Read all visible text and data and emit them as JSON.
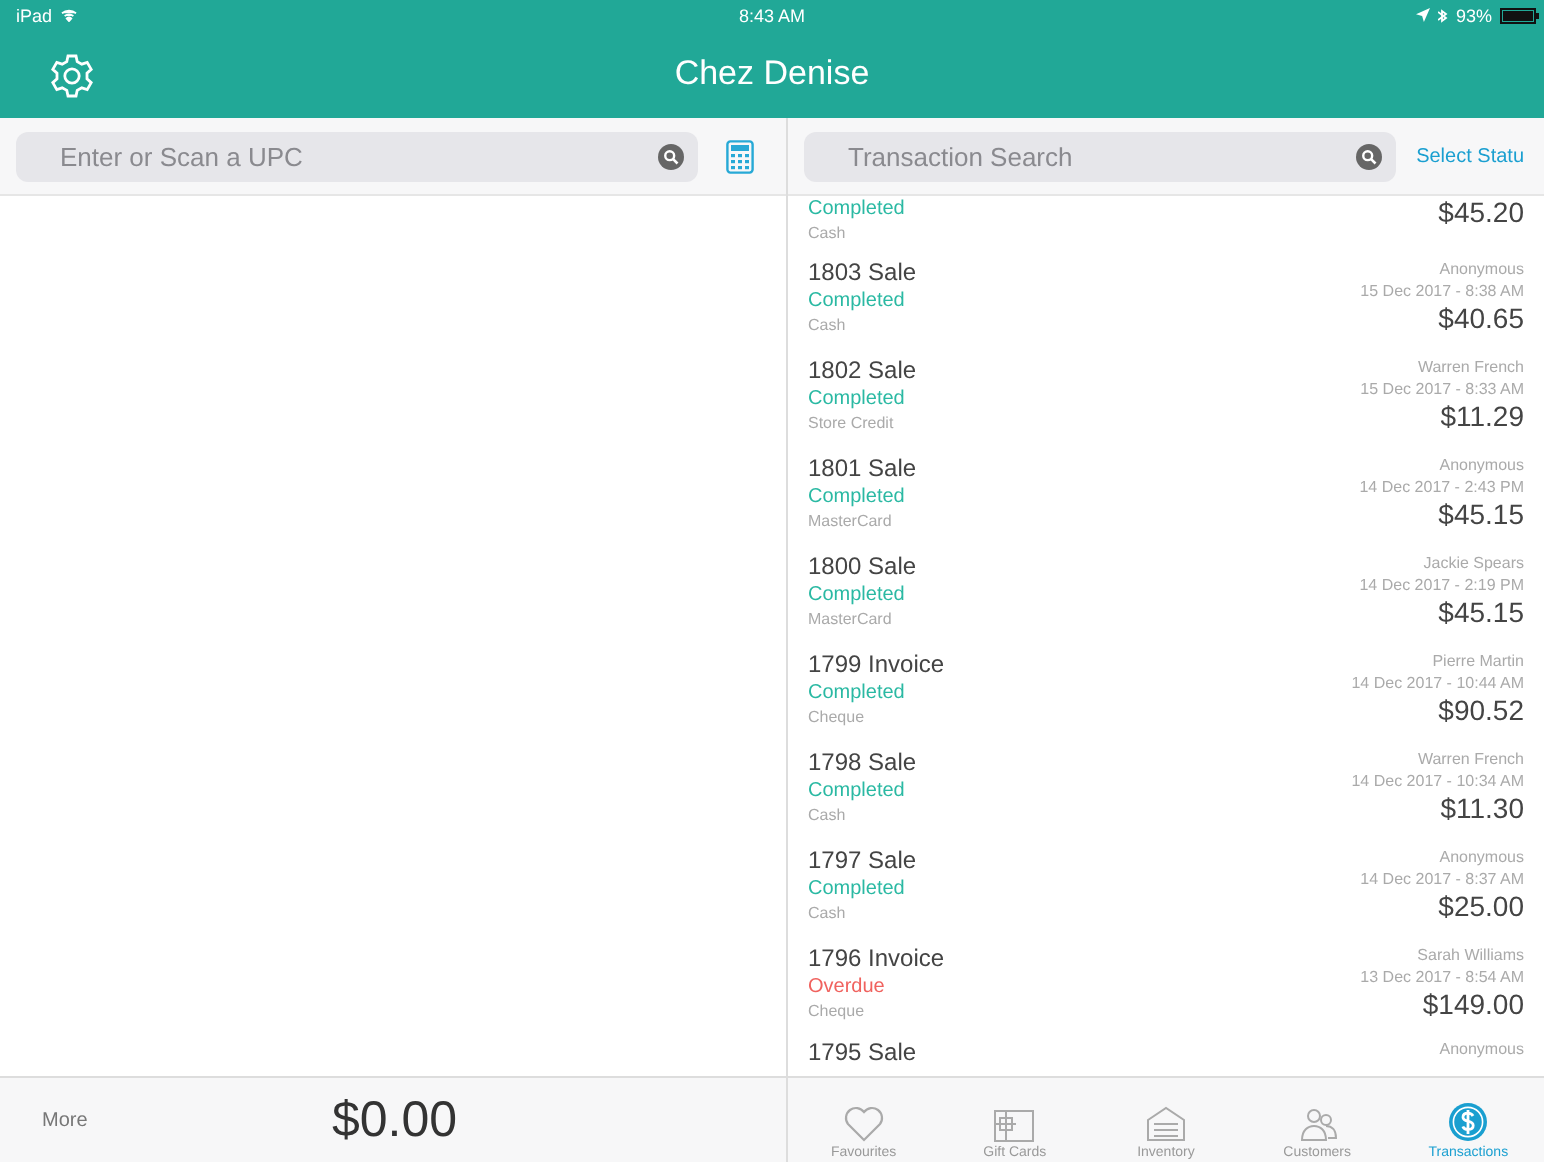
{
  "status_bar": {
    "device": "iPad",
    "time": "8:43 AM",
    "battery": "93%"
  },
  "header": {
    "title": "Chez Denise"
  },
  "left": {
    "search": {
      "placeholder": "Enter or Scan a UPC"
    },
    "more": "More",
    "total": "$0.00"
  },
  "right": {
    "search": {
      "placeholder": "Transaction Search"
    },
    "filter": "Select Statu",
    "partial_top": {
      "status": "Completed",
      "overdue": false,
      "payment": "Cash",
      "amount": "$45.20"
    },
    "transactions": [
      {
        "title": "1803 Sale",
        "status": "Completed",
        "overdue": false,
        "payment": "Cash",
        "customer": "Anonymous",
        "date": "15 Dec 2017 - 8:38 AM",
        "amount": "$40.65"
      },
      {
        "title": "1802 Sale",
        "status": "Completed",
        "overdue": false,
        "payment": "Store Credit",
        "customer": "Warren French",
        "date": "15 Dec 2017 - 8:33 AM",
        "amount": "$11.29"
      },
      {
        "title": "1801 Sale",
        "status": "Completed",
        "overdue": false,
        "payment": "MasterCard",
        "customer": "Anonymous",
        "date": "14 Dec 2017 - 2:43 PM",
        "amount": "$45.15"
      },
      {
        "title": "1800 Sale",
        "status": "Completed",
        "overdue": false,
        "payment": "MasterCard",
        "customer": "Jackie Spears",
        "date": "14 Dec 2017 - 2:19 PM",
        "amount": "$45.15"
      },
      {
        "title": "1799 Invoice",
        "status": "Completed",
        "overdue": false,
        "payment": "Cheque",
        "customer": "Pierre Martin",
        "date": "14 Dec 2017 - 10:44 AM",
        "amount": "$90.52"
      },
      {
        "title": "1798 Sale",
        "status": "Completed",
        "overdue": false,
        "payment": "Cash",
        "customer": "Warren French",
        "date": "14 Dec 2017 - 10:34 AM",
        "amount": "$11.30"
      },
      {
        "title": "1797 Sale",
        "status": "Completed",
        "overdue": false,
        "payment": "Cash",
        "customer": "Anonymous",
        "date": "14 Dec 2017 - 8:37 AM",
        "amount": "$25.00"
      },
      {
        "title": "1796 Invoice",
        "status": "Overdue",
        "overdue": true,
        "payment": "Cheque",
        "customer": "Sarah Williams",
        "date": "13 Dec 2017 - 8:54 AM",
        "amount": "$149.00"
      }
    ],
    "partial_bottom": {
      "title": "1795 Sale",
      "customer": "Anonymous"
    }
  },
  "tabs": [
    {
      "label": "Favourites",
      "kind": "heart",
      "selected": false
    },
    {
      "label": "Gift Cards",
      "kind": "card",
      "selected": false
    },
    {
      "label": "Inventory",
      "kind": "store",
      "selected": false
    },
    {
      "label": "Customers",
      "kind": "people",
      "selected": false
    },
    {
      "label": "Transactions",
      "kind": "dollar",
      "selected": true
    }
  ]
}
